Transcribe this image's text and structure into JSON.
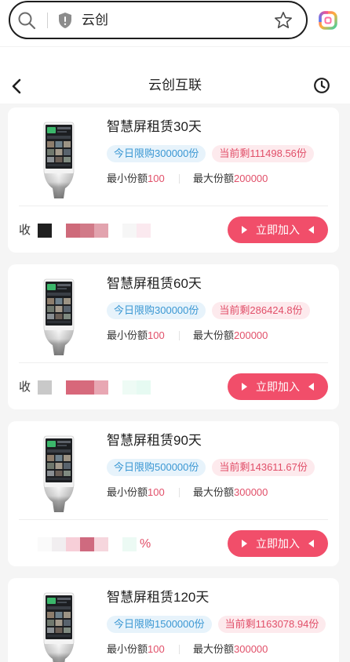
{
  "browser": {
    "address_text": "云创",
    "icons": [
      "search-icon",
      "shield-icon",
      "star-icon",
      "app-launcher-icon"
    ]
  },
  "header": {
    "title": "云创互联",
    "icons": [
      "chevron-left-icon",
      "clock-icon"
    ]
  },
  "labels": {
    "min_share": "最小份额",
    "max_share": "最大份额",
    "join_button": "立即加入"
  },
  "colors": {
    "accent": "#f14e6a",
    "page_bg": "#f5f5f5",
    "daily_limit_bg": "#e7f3fb",
    "daily_limit_text": "#3a97d3",
    "remaining_bg": "#fdeaed",
    "remaining_text": "#e14f69",
    "value_text": "#e14f69"
  },
  "cards": [
    {
      "title": "智慧屏租赁30天",
      "daily_limit": "今日限购300000份",
      "remaining": "当前剩111498.56份",
      "min_value": "100",
      "max_value": "200000",
      "yield_prefix": "收",
      "redacted_cells": [
        "#202020",
        "#ffffff",
        "#ce6a7a",
        "#d17a88",
        "#e2a3ae",
        "#ffffff",
        "#f6f6f6",
        "#fbe9ef"
      ]
    },
    {
      "title": "智慧屏租赁60天",
      "daily_limit": "今日限购300000份",
      "remaining": "当前剩286424.8份",
      "min_value": "100",
      "max_value": "200000",
      "yield_prefix": "收",
      "redacted_cells": [
        "#c9c9c9",
        "#ffffff",
        "#d8677a",
        "#d66b7d",
        "#e8a7b3",
        "#ffffff",
        "#eefbf5",
        "#e6faf2"
      ]
    },
    {
      "title": "智慧屏租赁90天",
      "daily_limit": "今日限购500000份",
      "remaining": "当前剩143611.67份",
      "min_value": "100",
      "max_value": "300000",
      "yield_suffix": "%",
      "redacted_cells": [
        "#fafafa",
        "#f1eef0",
        "#f7cfd8",
        "#cf6a7f",
        "#f6d6dd",
        "#ffffff",
        "#ecfaf4"
      ]
    },
    {
      "title": "智慧屏租赁120天",
      "daily_limit": "今日限购1500000份",
      "remaining": "当前剩1163078.94份",
      "min_value": "100",
      "max_value": "300000"
    }
  ]
}
